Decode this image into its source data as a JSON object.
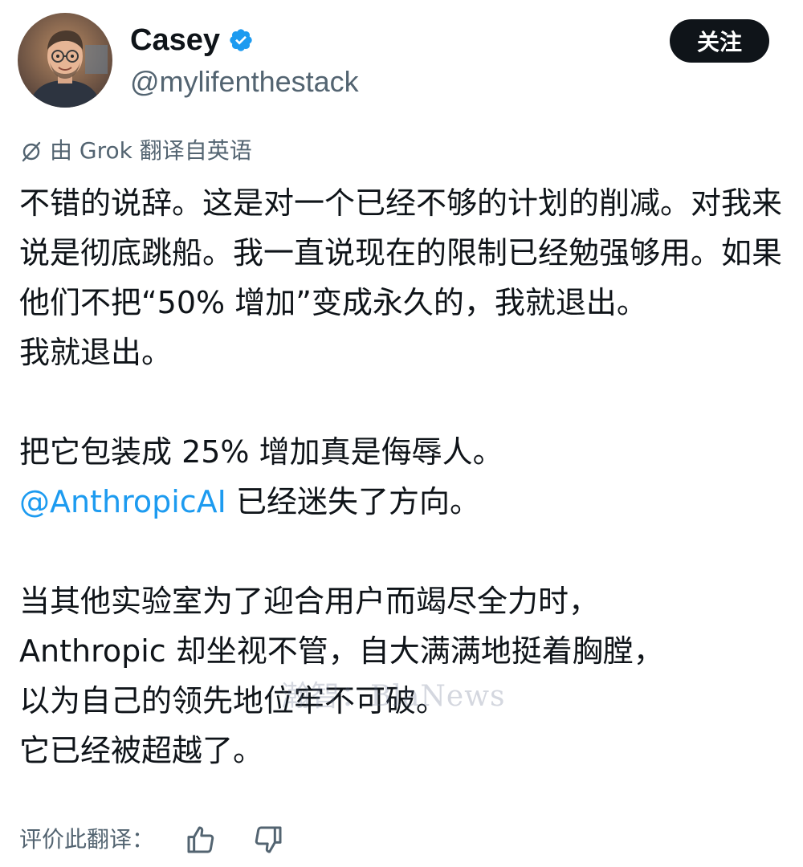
{
  "author": {
    "display_name": "Casey",
    "handle": "@mylifenthestack",
    "verified": true
  },
  "follow_button": {
    "label": "关注"
  },
  "translation": {
    "icon": "translate-icon",
    "label": "由 Grok 翻译自英语"
  },
  "body": {
    "p1": "不错的说辞。这是对一个已经不够的计划的削减。对我来说是彻底跳船。我一直说现在的限制已经勉强够用。如果他们不把“50% 增加”变成永久的，我就退出。",
    "p2": "我就退出。",
    "p3": "把它包装成 25% 增加真是侮辱人。",
    "mention": "@AnthropicAI",
    "p4_rest": " 已经迷失了方向。",
    "p5": "当其他实验室为了迎合用户而竭尽全力时，",
    "p6": "Anthropic 却坐视不管，自大满满地挺着胸膛，",
    "p7": "以为自己的领先地位牢不可破。",
    "p8": "它已经被超越了。"
  },
  "watermark": "瀚智：BlaNews",
  "rate_translation": {
    "label": "评价此翻译：",
    "up_icon": "thumbs-up-icon",
    "down_icon": "thumbs-down-icon"
  },
  "colors": {
    "text": "#0f1419",
    "secondary": "#536471",
    "link": "#1d9bf0",
    "verified": "#1d9bf0",
    "button_bg": "#0f1419"
  }
}
